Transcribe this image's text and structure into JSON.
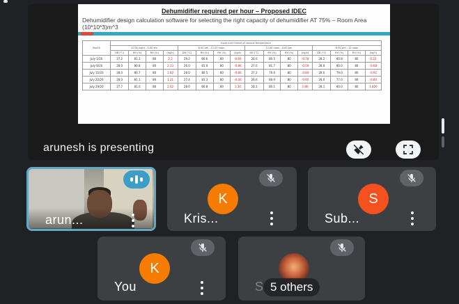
{
  "presentation": {
    "presenter_label": "arunesh is presenting",
    "slide": {
      "title": "Dehumidifier required per hour – Proposed IDEC",
      "subtitle": "Dehumidifier design calculation software for selecting the right capacity of dehumidifier AT 75% – Room Area (10*10*3)m^3",
      "table": {
        "month_header": "Month",
        "group_header": "Input and Outout of various temperature",
        "period_headers": [
          "12.00 night - 3.00 am",
          "6.00 am - 12.00 noon",
          "12.00 noon - 6.00 pm",
          "6.00 pm - 12 noon"
        ],
        "col_headers": [
          "DB (°C)",
          "RH (%)",
          "RH (%)",
          "(kg/h)",
          "DB (°C)",
          "RH (%)",
          "RH (%)",
          "(kg/h)",
          "DB (°C)",
          "RH (%)",
          "RH (%)",
          "(kg/h)",
          "DB (°C)",
          "RH (%)",
          "RH (%)",
          "(kg/h)"
        ],
        "rows": [
          {
            "month": "July 1/20",
            "cells": [
              "27.2",
              "81.3",
              "80",
              "2.2",
              "29.2",
              "80.6",
              "80",
              "-0.60",
              "28.0",
              "80.5",
              "80",
              "-0.78",
              "28.2",
              "80.8",
              "80",
              "0.22"
            ]
          },
          {
            "month": "July 8/20",
            "cells": [
              "28.0",
              "80.8",
              "80",
              "2.13",
              "26.0",
              "81.0",
              "80",
              "-0.86",
              "27.0",
              "81.7",
              "80",
              "-0.59",
              "28.0",
              "80.0",
              "80",
              "-0.68"
            ]
          },
          {
            "month": "July 15/20",
            "cells": [
              "28.0",
              "80.7",
              "80",
              "1.82",
              "28.0",
              "80.5",
              "80",
              "-0.80",
              "27.2",
              "79.0",
              "80",
              "-0.84",
              "28.0",
              "79.0",
              "80",
              "-0.92"
            ]
          },
          {
            "month": "July 22/20",
            "cells": [
              "28.0",
              "81.1",
              "80",
              "1.21",
              "27.4",
              "81.3",
              "80",
              "-0.40",
              "26.0",
              "80.0",
              "80",
              "-0.92",
              "28.0",
              "77.0",
              "80",
              "-0.80"
            ]
          },
          {
            "month": "July 29/20",
            "cells": [
              "27.7",
              "81.0",
              "80",
              "2.02",
              "28.0",
              "80.8",
              "80",
              "1.30",
              "28.3",
              "80.1",
              "80",
              "1.80",
              "28.1",
              "80.0",
              "80",
              "1.820"
            ]
          }
        ]
      }
    },
    "unpin_icon": "pin-off-icon",
    "fullscreen_icon": "fullscreen-icon"
  },
  "participants": [
    {
      "name": "arun...",
      "state": "speaking",
      "icon": "audio-level-icon"
    },
    {
      "name": "Kris...",
      "avatar_letter": "K",
      "avatar_color": "#f57c00",
      "icon": "mic-off-icon"
    },
    {
      "name": "Sub...",
      "avatar_letter": "S",
      "avatar_color": "#f4511e",
      "icon": "mic-off-icon"
    },
    {
      "name": "You",
      "avatar_letter": "K",
      "avatar_color": "#f57c00",
      "icon": "mic-off-icon"
    },
    {
      "name": "S",
      "others_label": "5 others",
      "icon": "mic-off-icon"
    }
  ],
  "colors": {
    "background": "#202124",
    "tile": "#3c4043",
    "active_border": "#61a8c6",
    "speaking_badge": "#3d9dc9"
  }
}
